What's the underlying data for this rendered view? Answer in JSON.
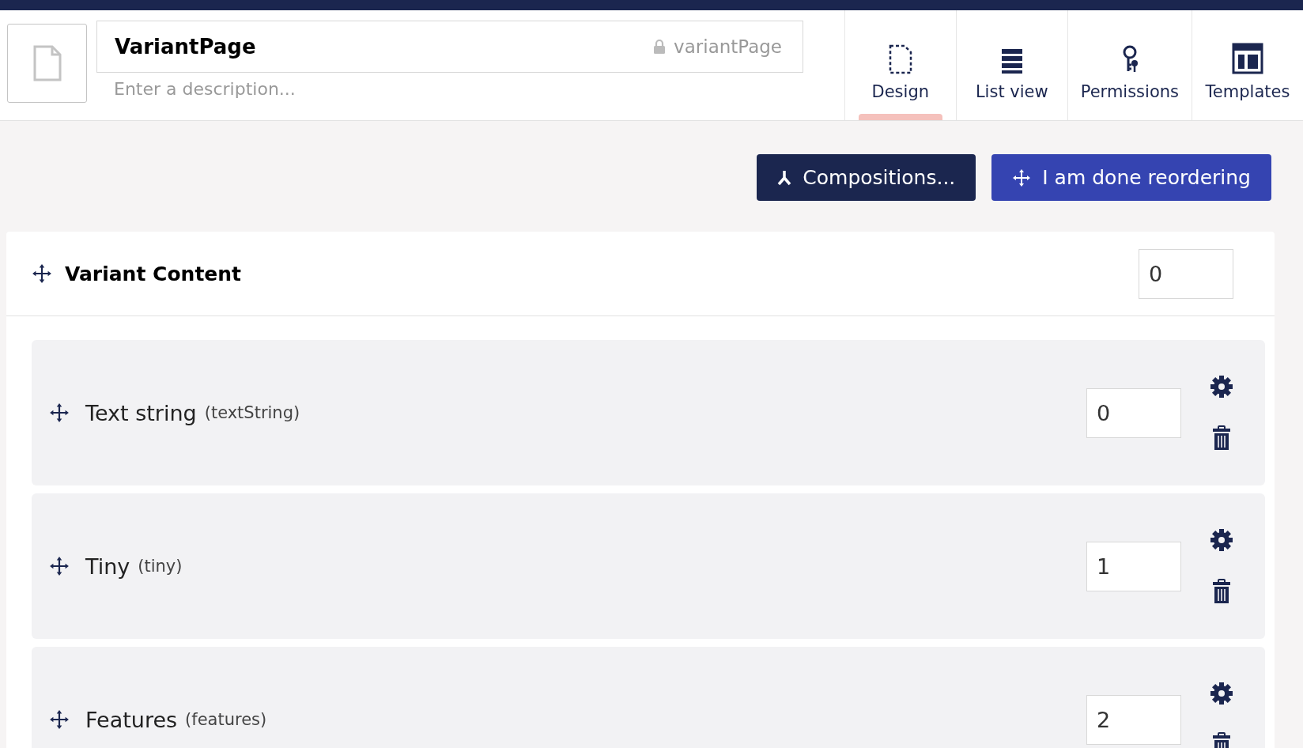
{
  "header": {
    "name": "VariantPage",
    "alias": "variantPage",
    "description_placeholder": "Enter a description..."
  },
  "tabs": [
    {
      "label": "Design",
      "kind": "design",
      "selected": true
    },
    {
      "label": "List view",
      "kind": "list",
      "selected": false
    },
    {
      "label": "Permissions",
      "kind": "permissions",
      "selected": false
    },
    {
      "label": "Templates",
      "kind": "templates",
      "selected": false
    }
  ],
  "buttons": [
    {
      "label": "Compositions...",
      "kind": "compositions"
    },
    {
      "label": "I am done reordering",
      "kind": "reorder"
    }
  ],
  "group": {
    "name": "Variant Content",
    "sort_order": "0",
    "properties": [
      {
        "name": "Text string",
        "alias": "(textString)",
        "sort_order": "0"
      },
      {
        "name": "Tiny",
        "alias": "(tiny)",
        "sort_order": "1"
      },
      {
        "name": "Features",
        "alias": "(features)",
        "sort_order": "2"
      }
    ]
  }
}
